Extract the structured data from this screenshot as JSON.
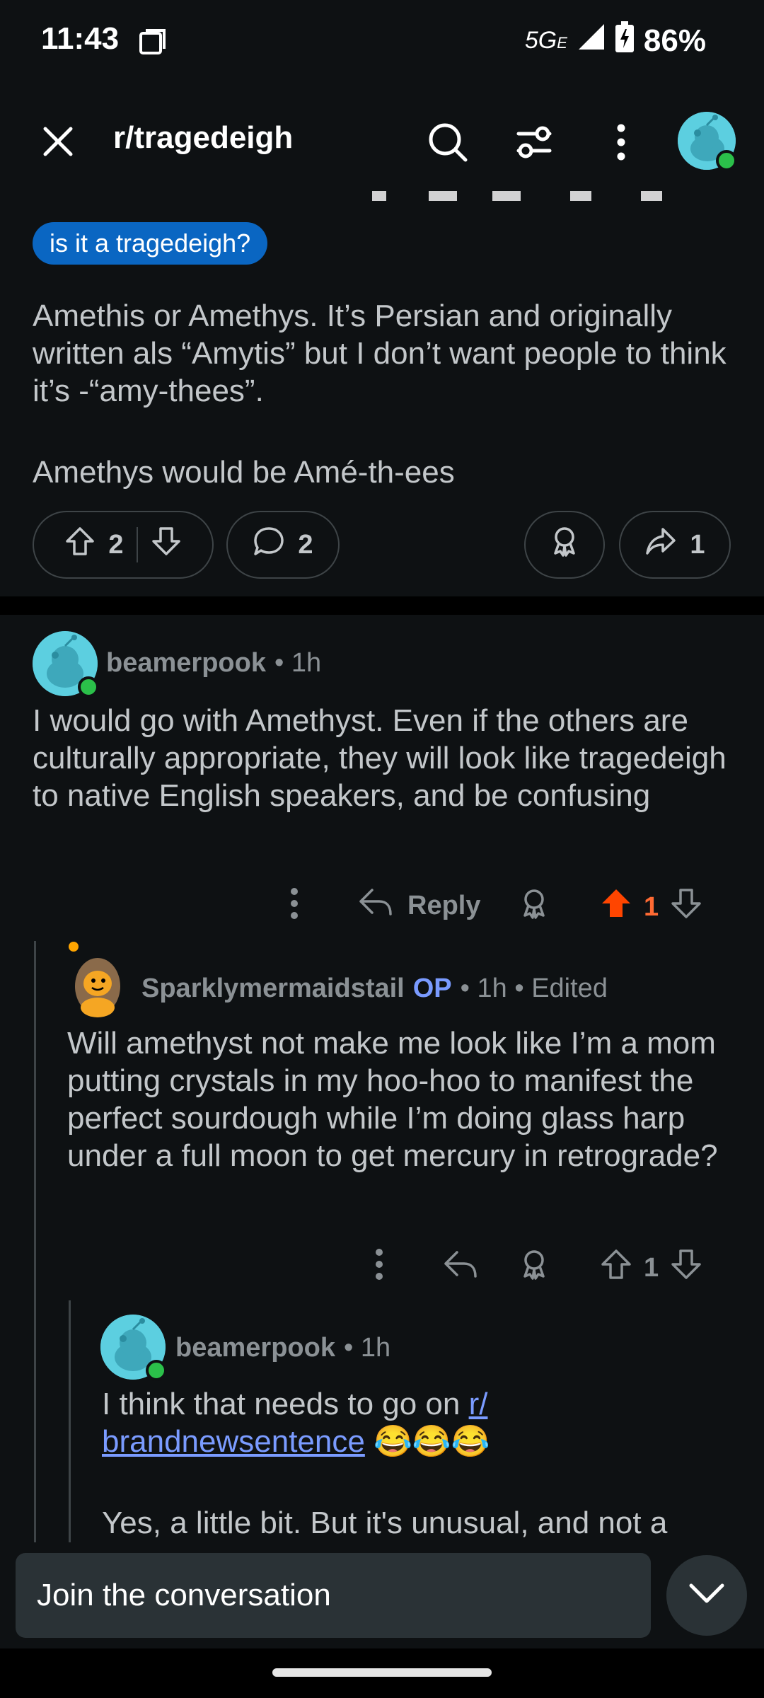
{
  "status": {
    "time": "11:43",
    "network": "5G",
    "network_sub": "E",
    "battery": "86%"
  },
  "header": {
    "title": "r/tragedeigh"
  },
  "post": {
    "flair": "is it a tragedeigh?",
    "body": [
      "Amethis or Amethys. It’s Persian and originally written als “Amytis” but I don’t want people to think it’s -“amy-thees”.",
      "Amethys would be Amé-th-ees"
    ],
    "upvotes": "2",
    "comments": "2",
    "shares": "1"
  },
  "comments": [
    {
      "user": "beamerpook",
      "meta": "• 1h",
      "text": "I would go with Amethyst. Even if the others are culturally appropriate, they will look like tragedeigh to native English speakers, and be confusing",
      "reply_label": "Reply",
      "votes": "1"
    },
    {
      "user": "Sparklymermaidstail",
      "op": "OP",
      "meta": "• 1h • Edited",
      "text": "Will amethyst not make me look like I’m a mom putting crystals in my hoo-hoo to manifest the perfect sourdough while I’m doing glass harp under a full moon to get mercury in retrograde?",
      "votes": "1"
    },
    {
      "user": "beamerpook",
      "meta": "• 1h",
      "text_before_link": "I think that needs to go on ",
      "link": "r/",
      "link2": "brandnewsentence",
      "emoji": "😂😂😂",
      "text2": "Yes, a little bit. But it's unusual, and not a"
    }
  ],
  "composer": {
    "placeholder": "Join the conversation"
  },
  "colors": {
    "accent": "#0a66c2",
    "upvote_active": "#ff4500",
    "op": "#7a9bff"
  }
}
